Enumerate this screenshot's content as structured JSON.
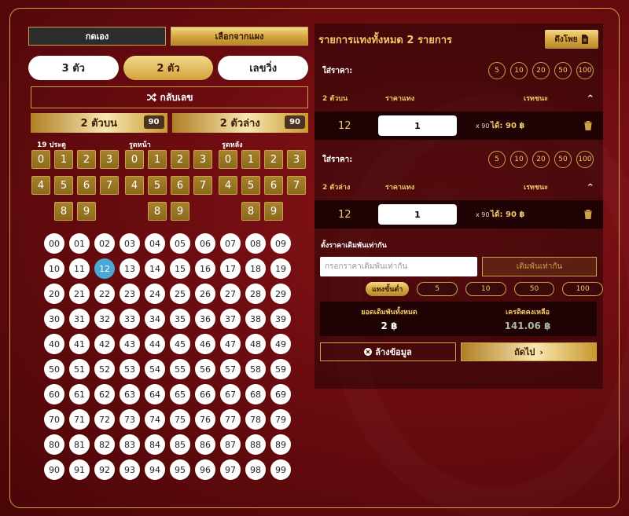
{
  "tabs": {
    "manual": "กดเอง",
    "panel": "เลือกจากแผง"
  },
  "modes": [
    "3 ตัว",
    "2 ตัว",
    "เลขวิ่ง"
  ],
  "reverse": {
    "icon": "shuffle-icon",
    "label": "กลับเลข"
  },
  "categories": [
    {
      "label": "2 ตัวบน",
      "rate": "90"
    },
    {
      "label": "2 ตัวล่าง",
      "rate": "90"
    }
  ],
  "digit_labels": [
    "19 ประตู",
    "รูดหน้า",
    "รูดหลัง"
  ],
  "digits_rows": [
    [
      "0",
      "1",
      "2",
      "3"
    ],
    [
      "4",
      "5",
      "6",
      "7"
    ],
    [
      "8",
      "9"
    ]
  ],
  "numbers": [
    "00",
    "01",
    "02",
    "03",
    "04",
    "05",
    "06",
    "07",
    "08",
    "09",
    "10",
    "11",
    "12",
    "13",
    "14",
    "15",
    "16",
    "17",
    "18",
    "19",
    "20",
    "21",
    "22",
    "23",
    "24",
    "25",
    "26",
    "27",
    "28",
    "29",
    "30",
    "31",
    "32",
    "33",
    "34",
    "35",
    "36",
    "37",
    "38",
    "39",
    "40",
    "41",
    "42",
    "43",
    "44",
    "45",
    "46",
    "47",
    "48",
    "49",
    "50",
    "51",
    "52",
    "53",
    "54",
    "55",
    "56",
    "57",
    "58",
    "59",
    "60",
    "61",
    "62",
    "63",
    "64",
    "65",
    "66",
    "67",
    "68",
    "69",
    "70",
    "71",
    "72",
    "73",
    "74",
    "75",
    "76",
    "77",
    "78",
    "79",
    "80",
    "81",
    "82",
    "83",
    "84",
    "85",
    "86",
    "87",
    "88",
    "89",
    "90",
    "91",
    "92",
    "93",
    "94",
    "95",
    "96",
    "97",
    "98",
    "99"
  ],
  "selected_number": "12",
  "right": {
    "title": "รายการแทงทั้งหมด 2 รายการ",
    "pull_button": "ดึงโพย",
    "sections": [
      {
        "price_label": "ใส่ราคา:",
        "chips": [
          "5",
          "10",
          "20",
          "50",
          "100"
        ],
        "type": "2 ตัวบน",
        "col_price": "ราคาแทง",
        "col_rate": "เรทชนะ",
        "number": "12",
        "amount": "1",
        "mult": "x 90",
        "win": "ได้: 90 ฿"
      },
      {
        "price_label": "ใส่ราคา:",
        "chips": [
          "5",
          "10",
          "20",
          "50",
          "100"
        ],
        "type": "2 ตัวล่าง",
        "col_price": "ราคาแทง",
        "col_rate": "เรทชนะ",
        "number": "12",
        "amount": "1",
        "mult": "x 90",
        "win": "ได้: 90 ฿"
      }
    ],
    "default_title": "ตั้งราคาเดิมพันเท่ากัน",
    "default_placeholder": "กรอกราคาเดิมพันเท่ากัน",
    "default_button": "เดิมพันเท่ากัน",
    "min_label": "แทงขั้นต่ำ",
    "min_chips": [
      "5",
      "10",
      "50",
      "100"
    ],
    "total_label": "ยอดเดิมพันทั้งหมด",
    "total_value": "2 ฿",
    "credit_label": "เครดิตคงเหลือ",
    "credit_value": "141.06 ฿",
    "clear_button": "ล้างข้อมูล",
    "next_button": "ถัดไป"
  }
}
